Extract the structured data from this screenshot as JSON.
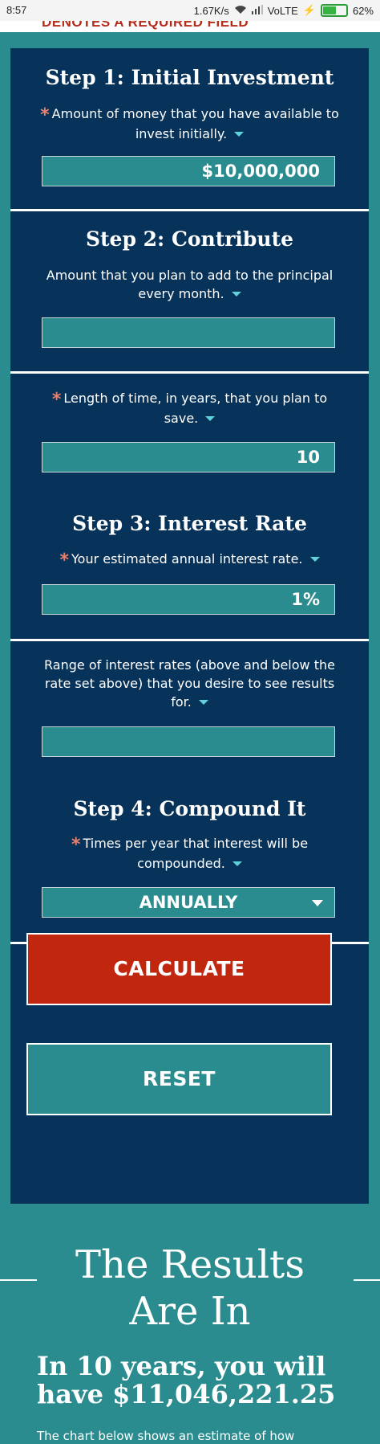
{
  "status_bar": {
    "time": "8:57",
    "speed": "1.67K/s",
    "network": "VoLTE",
    "battery": "62%",
    "battery_level": 0.62
  },
  "required_note": "DENOTES A REQUIRED FIELD",
  "step1": {
    "heading": "Step 1: Initial Investment",
    "label": "Amount of money that you have available to invest initially.",
    "value": "$10,000,000"
  },
  "step2": {
    "heading": "Step 2: Contribute",
    "contribution_label": "Amount that you plan to add to the principal every month.",
    "contribution_value": "",
    "years_label": "Length of time, in years, that you plan to save.",
    "years_value": "10"
  },
  "step3": {
    "heading": "Step 3: Interest Rate",
    "rate_label": "Your estimated annual interest rate.",
    "rate_value": "1%",
    "range_label": "Range of interest rates (above and below the rate set above) that you desire to see results for.",
    "range_value": ""
  },
  "step4": {
    "heading": "Step 4: Compound It",
    "label": "Times per year that interest will be compounded.",
    "selected": "ANNUALLY"
  },
  "buttons": {
    "calculate": "CALCULATE",
    "reset": "RESET"
  },
  "results": {
    "title": "The Results Are In",
    "summary_prefix": "In 10 years, you will have ",
    "summary_amount": "$11,046,221.25",
    "chart_note": "The chart below shows an estimate of how"
  },
  "colors": {
    "background": "#2b8c8f",
    "panel": "#073259",
    "calculate": "#c1260f",
    "required_asterisk": "#e9806d"
  }
}
